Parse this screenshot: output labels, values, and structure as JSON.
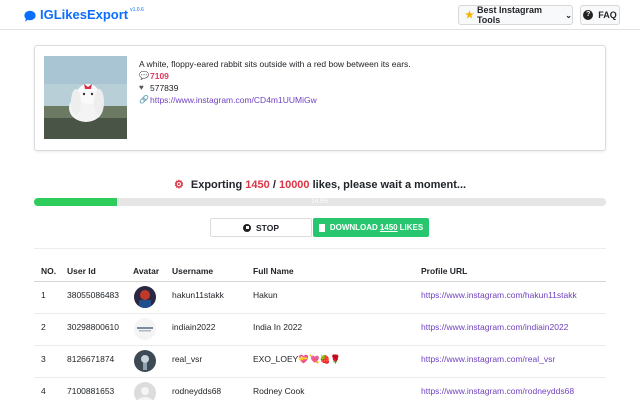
{
  "header": {
    "app_name": "IGLikesExport",
    "version": "v1.0.6",
    "tools_label": "Best Instagram Tools",
    "faq_label": "FAQ"
  },
  "post": {
    "caption": "A white, floppy-eared rabbit sits outside with a red bow between its ears.",
    "comments": "7109",
    "likes": "577839",
    "url": "https://www.instagram.com/CD4m1UUMiGw"
  },
  "progress": {
    "prefix": "Exporting",
    "current": "1450",
    "separator": "/",
    "total": "10000",
    "suffix": "likes, please wait a moment...",
    "percent_label": "14.5%",
    "fraction": 0.145
  },
  "actions": {
    "stop_label": "STOP",
    "download_prefix": "DOWNLOAD",
    "download_count": "1450",
    "download_suffix": "LIKES"
  },
  "table": {
    "headers": [
      "NO.",
      "User Id",
      "Avatar",
      "Username",
      "Full Name",
      "Profile URL"
    ],
    "rows": [
      {
        "no": "1",
        "user_id": "38055086483",
        "username": "hakun11stakk",
        "full_name": "Hakun",
        "url": "https://www.instagram.com/hakun11stakk"
      },
      {
        "no": "2",
        "user_id": "30298800610",
        "username": "indiain2022",
        "full_name": "India In 2022",
        "url": "https://www.instagram.com/indiain2022"
      },
      {
        "no": "3",
        "user_id": "8126671874",
        "username": "real_vsr",
        "full_name": "EXO_LOEY💝💘🍓🌹",
        "url": "https://www.instagram.com/real_vsr"
      },
      {
        "no": "4",
        "user_id": "7100881653",
        "username": "rodneydds68",
        "full_name": "Rodney Cook",
        "url": "https://www.instagram.com/rodneydds68"
      }
    ]
  },
  "colors": {
    "brand": "#0d6efd",
    "accent_red": "#dc3545",
    "progress": "#2ecc5b",
    "download": "#28c76f",
    "link": "#6f42c1"
  },
  "icons": [
    "chat-bubble-icon",
    "star-icon",
    "chevron-down-icon",
    "question-circle-icon",
    "comment-icon",
    "heart-icon",
    "link-icon",
    "gear-icon",
    "stop-circle-icon",
    "file-icon"
  ]
}
